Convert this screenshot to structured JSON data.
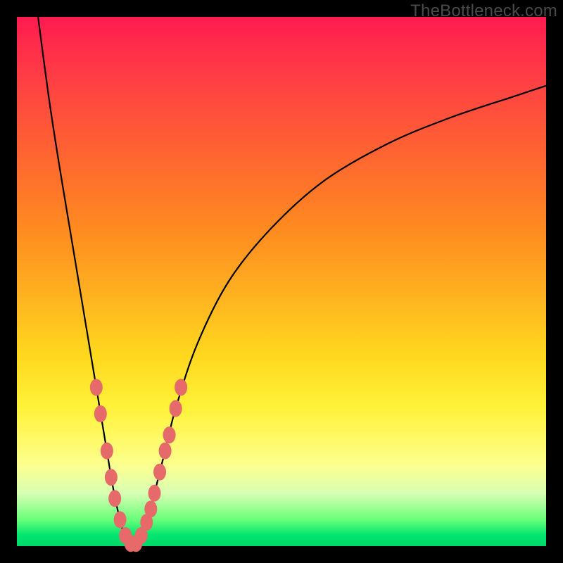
{
  "watermark": "TheBottleneck.com",
  "colors": {
    "frame": "#000000",
    "curve": "#000000",
    "marker_fill": "#e66a6a",
    "marker_stroke": "#c74f4f"
  },
  "chart_data": {
    "type": "line",
    "title": "",
    "xlabel": "",
    "ylabel": "",
    "xlim": [
      0,
      100
    ],
    "ylim": [
      0,
      100
    ],
    "grid": false,
    "series": [
      {
        "name": "left-branch",
        "x": [
          4,
          6,
          8,
          10,
          12,
          14,
          15,
          16,
          17,
          18,
          19,
          20,
          21,
          22
        ],
        "y": [
          100,
          85,
          72,
          60,
          48,
          36,
          30,
          24,
          18,
          12,
          7,
          3,
          1,
          0
        ]
      },
      {
        "name": "right-branch",
        "x": [
          22,
          23,
          24,
          25,
          26,
          28,
          30,
          34,
          40,
          48,
          58,
          70,
          82,
          94,
          100
        ],
        "y": [
          0,
          1,
          3,
          6,
          10,
          18,
          26,
          38,
          50,
          60,
          69,
          76,
          81,
          85,
          87
        ]
      }
    ],
    "markers": [
      {
        "branch": "left",
        "x": 15.0,
        "y": 30
      },
      {
        "branch": "left",
        "x": 15.8,
        "y": 25
      },
      {
        "branch": "left",
        "x": 17.0,
        "y": 18
      },
      {
        "branch": "left",
        "x": 17.8,
        "y": 13
      },
      {
        "branch": "left",
        "x": 18.5,
        "y": 9
      },
      {
        "branch": "left",
        "x": 19.5,
        "y": 5
      },
      {
        "branch": "left",
        "x": 20.5,
        "y": 2
      },
      {
        "branch": "left",
        "x": 21.5,
        "y": 0.5
      },
      {
        "branch": "right",
        "x": 22.5,
        "y": 0.5
      },
      {
        "branch": "right",
        "x": 23.5,
        "y": 2
      },
      {
        "branch": "right",
        "x": 24.5,
        "y": 4.5
      },
      {
        "branch": "right",
        "x": 25.3,
        "y": 7
      },
      {
        "branch": "right",
        "x": 26.0,
        "y": 10
      },
      {
        "branch": "right",
        "x": 27.0,
        "y": 14
      },
      {
        "branch": "right",
        "x": 28.0,
        "y": 18
      },
      {
        "branch": "right",
        "x": 28.8,
        "y": 21
      },
      {
        "branch": "right",
        "x": 30.0,
        "y": 26
      },
      {
        "branch": "right",
        "x": 31.0,
        "y": 30
      }
    ]
  }
}
